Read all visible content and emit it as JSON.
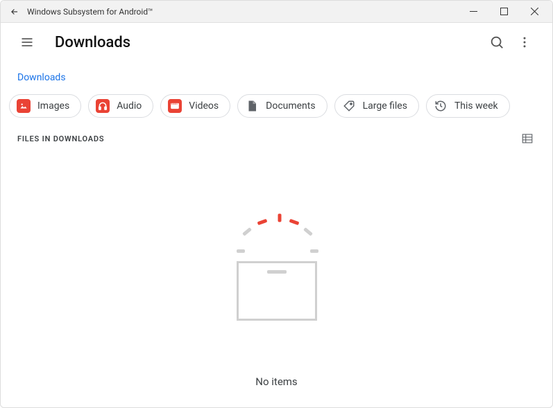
{
  "window": {
    "title": "Windows Subsystem for Android™"
  },
  "header": {
    "title": "Downloads"
  },
  "breadcrumb": {
    "current": "Downloads"
  },
  "chips": {
    "images": "Images",
    "audio": "Audio",
    "videos": "Videos",
    "documents": "Documents",
    "large_files": "Large files",
    "this_week": "This week"
  },
  "section": {
    "label": "FILES IN DOWNLOADS"
  },
  "empty": {
    "message": "No items"
  }
}
